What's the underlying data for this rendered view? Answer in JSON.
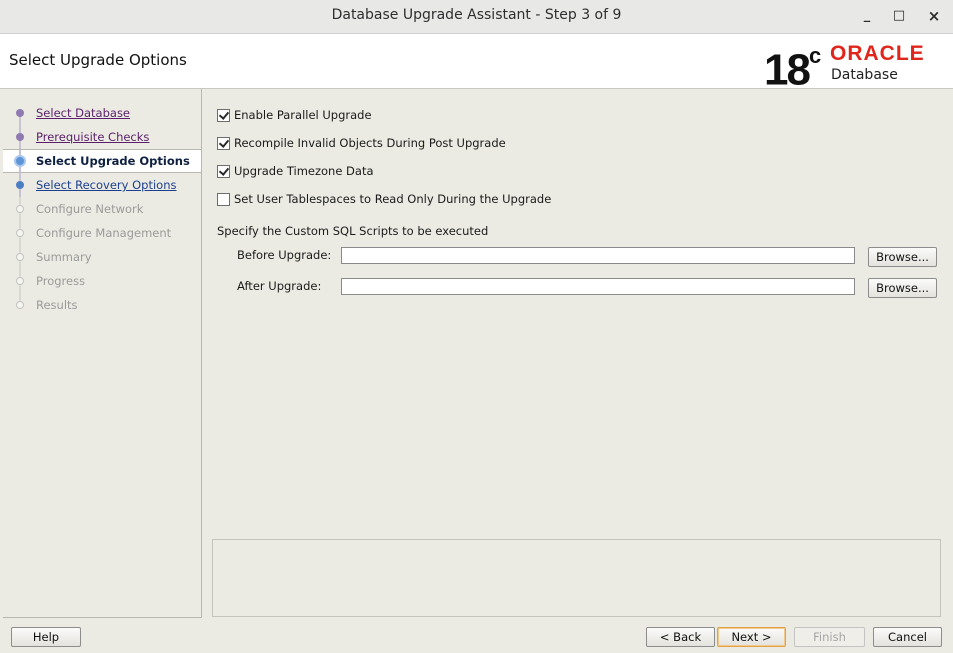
{
  "window": {
    "title": "Database Upgrade Assistant - Step 3 of 9",
    "controls": [
      "_",
      "□",
      "×"
    ]
  },
  "header": {
    "page_title": "Select Upgrade Options",
    "logo": {
      "version": "18",
      "version_suffix": "c",
      "brand": "ORACLE",
      "product": "Database"
    }
  },
  "steps": [
    {
      "label": "Select Database",
      "state": "visited"
    },
    {
      "label": "Prerequisite Checks",
      "state": "visited"
    },
    {
      "label": "Select Upgrade Options",
      "state": "current"
    },
    {
      "label": "Select Recovery Options",
      "state": "link"
    },
    {
      "label": "Configure Network",
      "state": "disabled"
    },
    {
      "label": "Configure Management",
      "state": "disabled"
    },
    {
      "label": "Summary",
      "state": "disabled"
    },
    {
      "label": "Progress",
      "state": "disabled"
    },
    {
      "label": "Results",
      "state": "disabled"
    }
  ],
  "options": [
    {
      "label": "Enable Parallel Upgrade",
      "checked": true
    },
    {
      "label": "Recompile Invalid Objects During Post Upgrade",
      "checked": true
    },
    {
      "label": "Upgrade Timezone Data",
      "checked": true
    },
    {
      "label": "Set User Tablespaces to Read Only During the Upgrade",
      "checked": false
    }
  ],
  "scripts": {
    "section_label": "Specify the Custom SQL Scripts to be executed",
    "before_label": "Before Upgrade:",
    "before_value": "",
    "after_label": "After Upgrade:",
    "after_value": "",
    "browse_label": "Browse..."
  },
  "footer": {
    "help": "Help",
    "back": "< Back",
    "next": "Next >",
    "finish": "Finish",
    "cancel": "Cancel"
  }
}
